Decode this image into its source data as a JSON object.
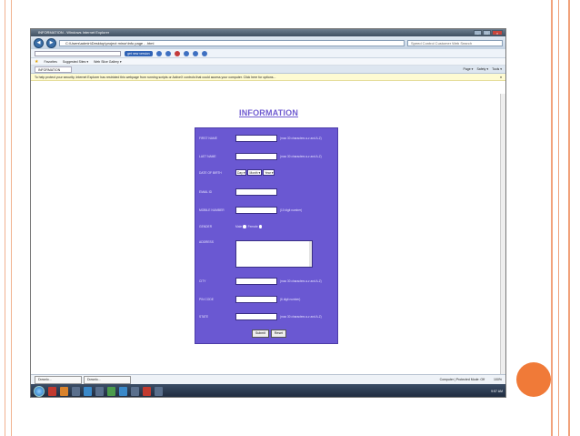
{
  "browser": {
    "window_title": "INFORMATION - Windows Internet Explorer",
    "address": "C:\\Users\\admin\\Desktop\\project minor\\info page - .html",
    "search_placeholder": "Speed Control Customer Web Search",
    "toolbar_button": "get new version",
    "favorites_label": "Favorites",
    "suggested_sites": "Suggested Sites ▾",
    "web_slice": "Web Slice Gallery ▾",
    "tab_title": "INFORMATION",
    "command_items": [
      "Page ▾",
      "Safety ▾",
      "Tools ▾"
    ],
    "infobar_text": "To help protect your security, Internet Explorer has restricted this webpage from running scripts or ActiveX controls that could access your computer. Click here for options...",
    "infobar_close": "×",
    "status_zone": "Computer | Protected Mode: Off",
    "zoom": "100%",
    "status_tabs": [
      "Downlo...",
      "Downlo..."
    ]
  },
  "page": {
    "heading": "INFORMATION",
    "fields": {
      "first_name": {
        "label": "FIRST NAME",
        "hint": "(max 30 characters a-z and A-Z)"
      },
      "last_name": {
        "label": "LAST NAME",
        "hint": "(max 30 characters a-z and A-Z)"
      },
      "dob": {
        "label": "DATE OF BIRTH",
        "day": "Day",
        "month": "Month",
        "year": "Year"
      },
      "email": {
        "label": "EMAIL ID"
      },
      "mobile": {
        "label": "MOBILE NUMBER",
        "hint": "(10 digit number)"
      },
      "gender": {
        "label": "GENDER",
        "male": "Male",
        "female": "Female"
      },
      "address": {
        "label": "ADDRESS"
      },
      "city": {
        "label": "CITY",
        "hint": "(max 30 characters a-z and A-Z)"
      },
      "pin": {
        "label": "PIN CODE",
        "hint": "(6 digit number)"
      },
      "state": {
        "label": "STATE",
        "hint": "(max 30 characters a-z and A-Z)"
      }
    },
    "submit_label": "Submit",
    "reset_label": "Reset"
  },
  "taskbar": {
    "clock": "9:57 AM"
  }
}
